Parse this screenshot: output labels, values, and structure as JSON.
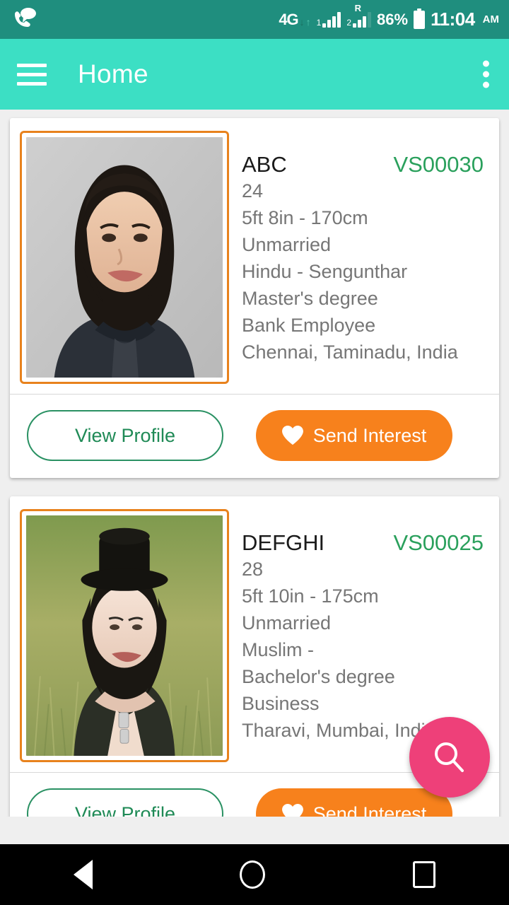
{
  "status_bar": {
    "notification_icon": "phone-message-icon",
    "network_type": "4G",
    "data_down_arrow": "↓",
    "data_up_arrow": "↑",
    "sim1_label": "1",
    "sim2_label": "2",
    "roaming_label": "R",
    "battery_percent": "86%",
    "battery_icon": "battery-icon",
    "time": "11:04",
    "meridiem": "AM",
    "background_color": "#1f8e7e"
  },
  "app_bar": {
    "menu_icon": "hamburger-menu-icon",
    "title": "Home",
    "overflow_icon": "three-dot-overflow-icon",
    "background_color": "#3cdfc4"
  },
  "fab": {
    "icon": "search-icon",
    "color": "#ee4079"
  },
  "nav_bar": {
    "back_label": "back",
    "home_label": "home",
    "recents_label": "recents"
  },
  "buttons": {
    "view_profile": "View Profile",
    "send_interest": "Send Interest",
    "heart_icon": "heart-icon",
    "outline_color": "#2a9163",
    "fill_color": "#f7811c"
  },
  "profiles": [
    {
      "name": "ABC",
      "id": "VS00030",
      "age": "24",
      "height": "5ft 8in - 170cm",
      "marital_status": "Unmarried",
      "religion_caste": "Hindu -  Sengunthar",
      "education": "Master's degree",
      "occupation": "Bank Employee",
      "location": "Chennai, Taminadu, India",
      "photo_alt": "portrait-woman-gray-background"
    },
    {
      "name": "DEFGHI",
      "id": "VS00025",
      "age": "28",
      "height": "5ft 10in - 175cm",
      "marital_status": "Unmarried",
      "religion_caste": "Muslim -",
      "education": "Bachelor's degree",
      "occupation": "Business",
      "location": "Tharavi, Mumbai, India",
      "photo_alt": "portrait-woman-top-hat-field"
    }
  ],
  "colors": {
    "page_background": "#eeeeee",
    "card_background": "#ffffff",
    "id_green": "#2aa05c",
    "detail_gray": "#767676",
    "photo_frame_orange": "#e8821d"
  }
}
